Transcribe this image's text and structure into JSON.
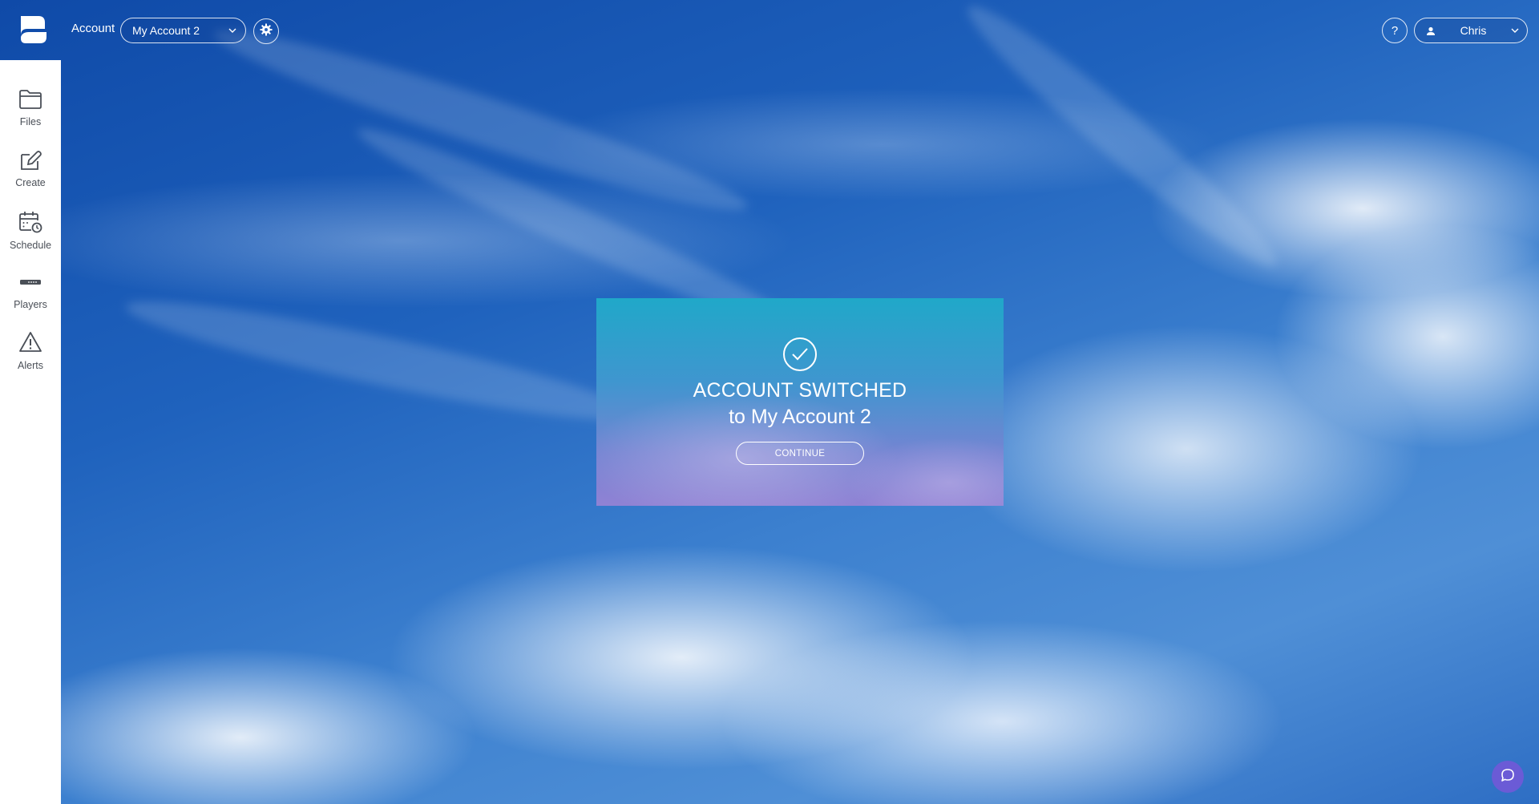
{
  "header": {
    "account_label": "Account",
    "account_selected": "My Account 2",
    "help_label": "?",
    "user_name": "Chris"
  },
  "sidebar": {
    "items": [
      {
        "label": "Files",
        "icon": "folder-icon"
      },
      {
        "label": "Create",
        "icon": "create-icon"
      },
      {
        "label": "Schedule",
        "icon": "calendar-clock-icon"
      },
      {
        "label": "Players",
        "icon": "player-device-icon"
      },
      {
        "label": "Alerts",
        "icon": "warning-icon"
      }
    ]
  },
  "modal": {
    "title": "ACCOUNT SWITCHED",
    "subtitle": "to My Account 2",
    "continue_label": "CONTINUE"
  },
  "colors": {
    "sidebar_bg": "#ffffff",
    "modal_top": "#20a8c9",
    "modal_bottom": "#9082d4",
    "chat_button": "#6b5bd6"
  }
}
